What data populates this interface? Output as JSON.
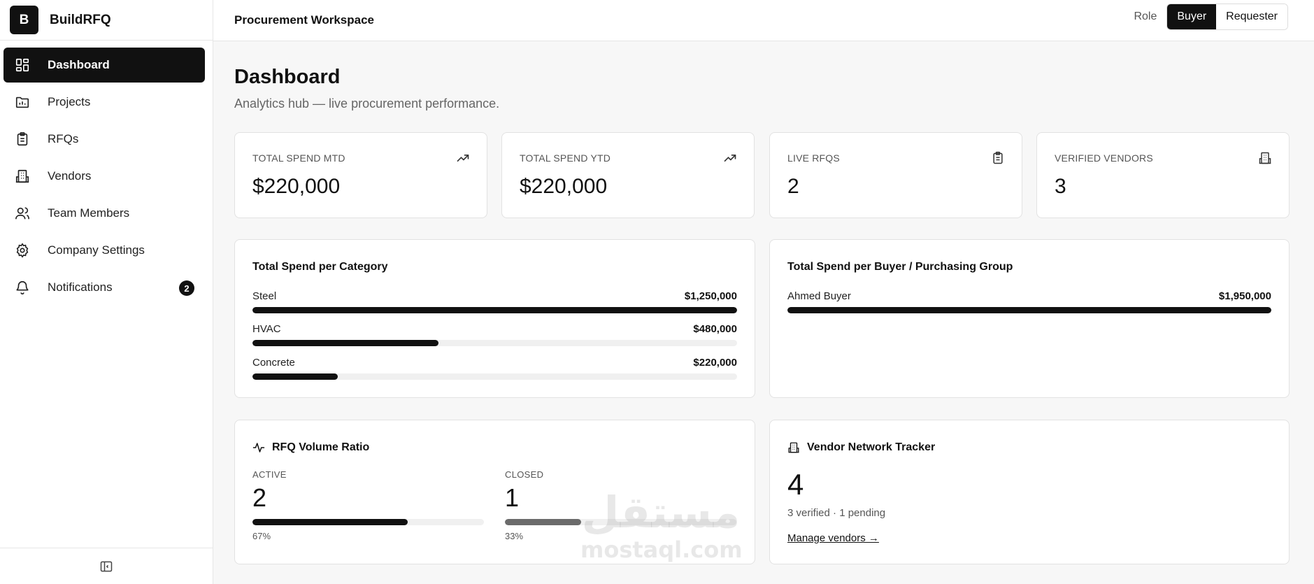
{
  "brand": {
    "logo_letter": "B",
    "name": "BuildRFQ"
  },
  "sidebar": {
    "items": [
      {
        "label": "Dashboard",
        "icon": "dashboard-icon",
        "active": true
      },
      {
        "label": "Projects",
        "icon": "folder-chart-icon"
      },
      {
        "label": "RFQs",
        "icon": "clipboard-icon"
      },
      {
        "label": "Vendors",
        "icon": "building-icon"
      },
      {
        "label": "Team Members",
        "icon": "users-icon"
      },
      {
        "label": "Company Settings",
        "icon": "gear-icon"
      },
      {
        "label": "Notifications",
        "icon": "bell-icon",
        "badge": "2"
      }
    ],
    "collapse_icon": "sidebar-collapse-icon"
  },
  "header": {
    "title": "Procurement Workspace",
    "role_label": "Role",
    "roles": [
      "Buyer",
      "Requester"
    ],
    "active_role": "Buyer"
  },
  "page": {
    "title": "Dashboard",
    "subtitle": "Analytics hub — live procurement performance."
  },
  "stats": [
    {
      "label": "TOTAL SPEND MTD",
      "value": "$220,000",
      "icon": "trending-up-icon"
    },
    {
      "label": "TOTAL SPEND YTD",
      "value": "$220,000",
      "icon": "trending-up-icon"
    },
    {
      "label": "LIVE RFQS",
      "value": "2",
      "icon": "clipboard-icon"
    },
    {
      "label": "VERIFIED VENDORS",
      "value": "3",
      "icon": "building-icon"
    }
  ],
  "spend_by_category": {
    "title": "Total Spend per Category",
    "rows": [
      {
        "name": "Steel",
        "value": "$1,250,000",
        "fraction": 1.0
      },
      {
        "name": "HVAC",
        "value": "$480,000",
        "fraction": 0.384
      },
      {
        "name": "Concrete",
        "value": "$220,000",
        "fraction": 0.176
      }
    ]
  },
  "spend_by_buyer": {
    "title": "Total Spend per Buyer / Purchasing Group",
    "rows": [
      {
        "name": "Ahmed Buyer",
        "value": "$1,950,000",
        "fraction": 1.0
      }
    ]
  },
  "rfq_ratio": {
    "title": "RFQ Volume Ratio",
    "icon": "activity-icon",
    "active": {
      "label": "ACTIVE",
      "value": "2",
      "pct": "67%",
      "fraction": 0.67,
      "color": "#111111"
    },
    "closed": {
      "label": "CLOSED",
      "value": "1",
      "pct": "33%",
      "fraction": 0.33,
      "color": "#6b6b6b"
    }
  },
  "vendor_tracker": {
    "title": "Vendor Network Tracker",
    "icon": "building-icon",
    "total": "4",
    "summary": "3 verified · 1 pending",
    "link": "Manage vendors →"
  },
  "watermark": {
    "arabic": "مستقل",
    "latin": "mostaql.com"
  }
}
